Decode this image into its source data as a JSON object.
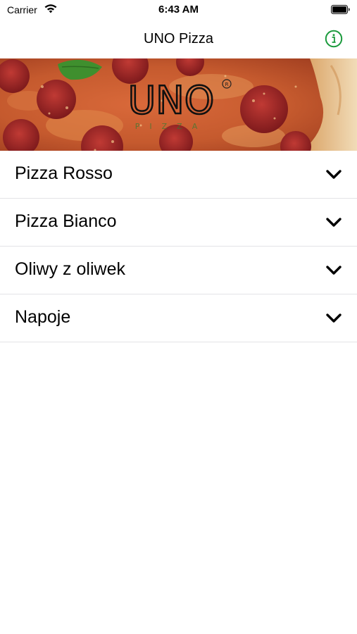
{
  "status_bar": {
    "carrier": "Carrier",
    "time": "6:43 AM"
  },
  "nav": {
    "title": "UNO Pizza",
    "info_icon": "info-circle-icon",
    "accent_color": "#1a9a3c"
  },
  "banner": {
    "logo_text": "UNO",
    "logo_subtext": "PIZZA"
  },
  "menu": {
    "items": [
      {
        "label": "Pizza Rosso",
        "icon": "chevron-down-icon"
      },
      {
        "label": "Pizza Bianco",
        "icon": "chevron-down-icon"
      },
      {
        "label": "Oliwy z oliwek",
        "icon": "chevron-down-icon"
      },
      {
        "label": "Napoje",
        "icon": "chevron-down-icon"
      }
    ]
  }
}
